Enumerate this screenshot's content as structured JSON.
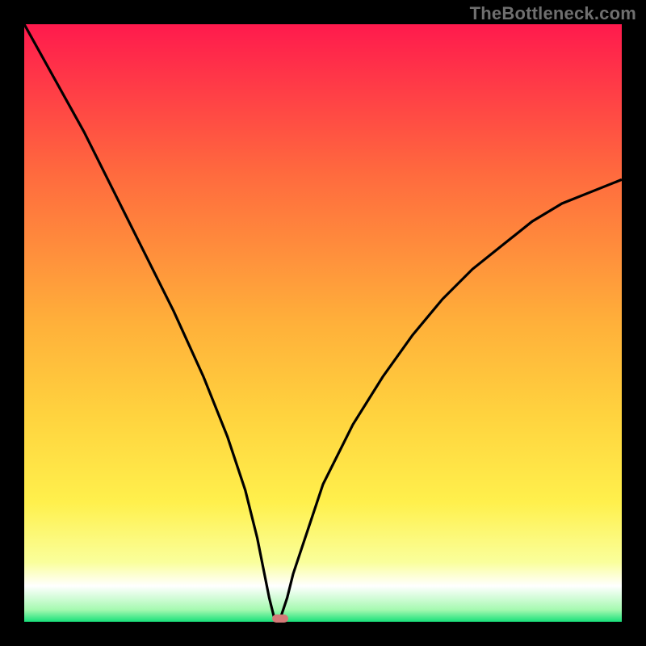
{
  "watermark": "TheBottleneck.com",
  "colors": {
    "gradient_stops": [
      {
        "at": 0,
        "color": "#ff1a4d"
      },
      {
        "at": 0.25,
        "color": "#ff6a3e"
      },
      {
        "at": 0.5,
        "color": "#ffb03a"
      },
      {
        "at": 0.65,
        "color": "#ffd23e"
      },
      {
        "at": 0.8,
        "color": "#fff04c"
      },
      {
        "at": 0.9,
        "color": "#faff9b"
      },
      {
        "at": 0.94,
        "color": "#ffffff"
      },
      {
        "at": 0.98,
        "color": "#a5f9b0"
      },
      {
        "at": 1.0,
        "color": "#18e07a"
      }
    ],
    "curve": "#000000",
    "marker": "#d47a78",
    "frame": "#000000"
  },
  "chart_data": {
    "type": "line",
    "title": "",
    "xlabel": "",
    "ylabel": "",
    "x_range": [
      0,
      100
    ],
    "y_range": [
      0,
      100
    ],
    "dip_x": 42,
    "series": [
      {
        "name": "bottleneck-curve",
        "x": [
          0,
          5,
          10,
          15,
          20,
          25,
          30,
          34,
          37,
          39,
          40,
          41,
          42,
          42.5,
          43,
          44,
          45,
          47,
          50,
          55,
          60,
          65,
          70,
          75,
          80,
          85,
          90,
          95,
          100
        ],
        "y": [
          100,
          91,
          82,
          72,
          62,
          52,
          41,
          31,
          22,
          14,
          9,
          4,
          0,
          0,
          1,
          4,
          8,
          14,
          23,
          33,
          41,
          48,
          54,
          59,
          63,
          67,
          70,
          72,
          74
        ]
      }
    ],
    "marker": {
      "x": 42.8,
      "y": 0.6
    }
  }
}
